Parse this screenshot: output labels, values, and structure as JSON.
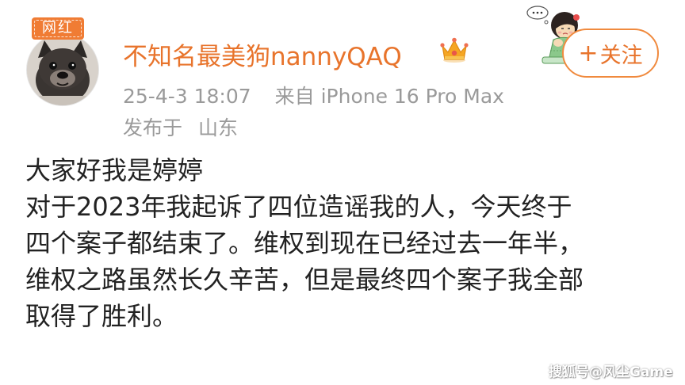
{
  "post": {
    "author": {
      "badge": "网红",
      "username": "不知名最美狗nannyQAQ",
      "crown_icon": "crown-icon",
      "avatar_icon": "bulldog-avatar"
    },
    "meta": {
      "timestamp": "25-4-3 18:07",
      "source": "来自 iPhone 16 Pro Max",
      "location_label": "发布于",
      "location": "山东"
    },
    "follow_button": {
      "plus": "+",
      "label": "关注"
    },
    "content_lines": [
      "大家好我是婷婷",
      "对于2023年我起诉了四位造谣我的人，今天终于",
      "四个案子都结束了。维权到现在已经过去一年半，",
      "维权之路虽然长久辛苦，但是最终四个案子我全部",
      "取得了胜利。"
    ]
  },
  "watermark": "搜狐号@风尘Game",
  "colors": {
    "accent": "#e8742c",
    "badge_bg": "#f07c34",
    "meta_text": "#9a9a9a",
    "body_text": "#222222"
  }
}
